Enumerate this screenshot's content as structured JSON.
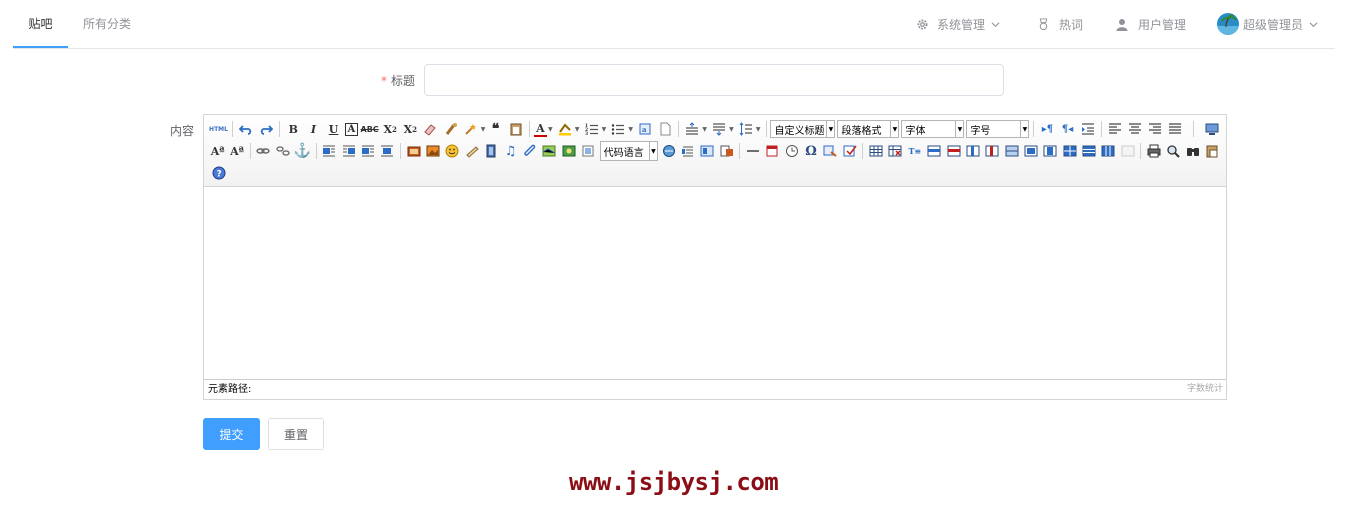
{
  "nav": {
    "tabs": [
      {
        "label": "贴吧",
        "active": true
      },
      {
        "label": "所有分类",
        "active": false
      }
    ],
    "system_menu": {
      "label": "系统管理",
      "icon": "gear-icon"
    },
    "hot_words": {
      "label": "热词",
      "icon": "medal-icon"
    },
    "user_mgmt": {
      "label": "用户管理",
      "icon": "user-icon"
    },
    "admin": {
      "label": "超级管理员",
      "icon": "avatar"
    }
  },
  "form": {
    "title_label": "标题",
    "title_required_mark": "*",
    "title_value": "",
    "content_label": "内容"
  },
  "editor": {
    "combos": {
      "code_language": "代码语言",
      "custom_title": "自定义标题",
      "paragraph_format": "段落格式",
      "font_family": "字体",
      "font_size": "字号"
    },
    "statusbar": {
      "path_label": "元素路径:",
      "word_count": "字数统计"
    }
  },
  "buttons": {
    "submit": "提交",
    "reset": "重置"
  },
  "watermark": "www.jsjbysj.com",
  "colors": {
    "primary": "#409eff",
    "active_tab_underline": "#409eff",
    "required": "#f56c6c",
    "watermark": "#8b0e17"
  }
}
